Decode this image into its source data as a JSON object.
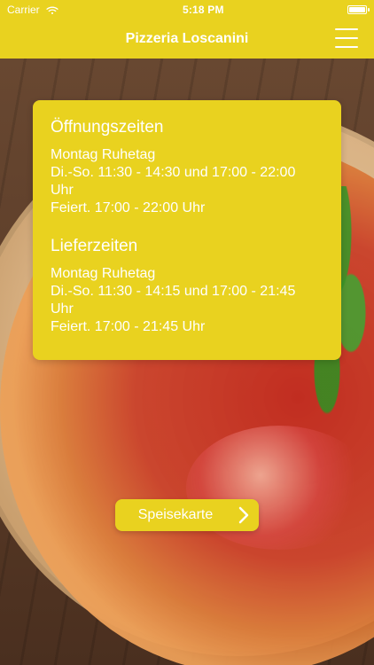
{
  "status_bar": {
    "carrier": "Carrier",
    "time": "5:18 PM"
  },
  "nav": {
    "title": "Pizzeria Loscanini"
  },
  "card": {
    "sections": [
      {
        "title": "Öffnungszeiten",
        "lines": [
          "Montag Ruhetag",
          "Di.-So. 11:30 - 14:30 und 17:00 - 22:00",
          "Uhr",
          "Feiert. 17:00 - 22:00 Uhr"
        ]
      },
      {
        "title": "Lieferzeiten",
        "lines": [
          "Montag Ruhetag",
          "Di.-So. 11:30 - 14:15 und 17:00 - 21:45",
          "Uhr",
          "Feiert. 17:00 - 21:45 Uhr"
        ]
      }
    ]
  },
  "bottom_button": {
    "label": "Speisekarte"
  },
  "colors": {
    "accent": "#e9d21f",
    "text": "#ffffff"
  }
}
